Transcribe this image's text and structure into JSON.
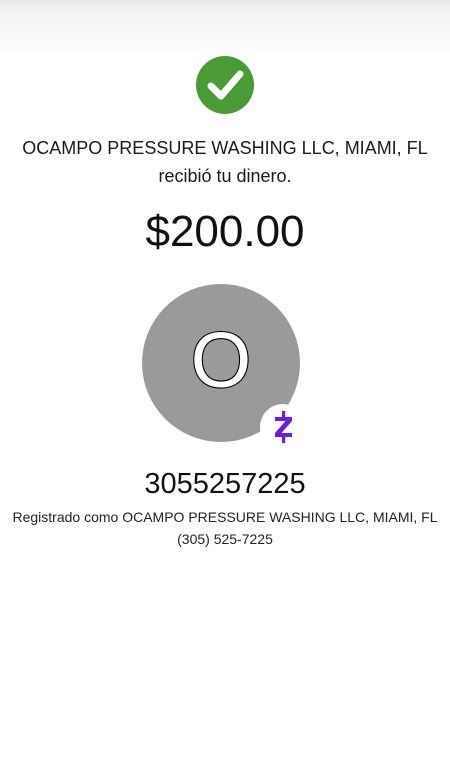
{
  "header": {
    "status_icon": "check-circle-icon",
    "status_color": "#4a9a35"
  },
  "recipient": {
    "name_line": "OCAMPO PRESSURE WASHING LLC, MIAMI, FL",
    "message": "recibió tu dinero."
  },
  "payment": {
    "amount": "$200.00"
  },
  "contact": {
    "avatar_initial": "O",
    "avatar_color": "#9a9a9a",
    "network_icon": "zelle-icon",
    "network_color": "#6d1ed4",
    "phone": "3055257225",
    "registered_as": "Registrado como OCAMPO PRESSURE WASHING LLC, MIAMI, FL",
    "formatted_phone": "(305) 525-7225"
  }
}
